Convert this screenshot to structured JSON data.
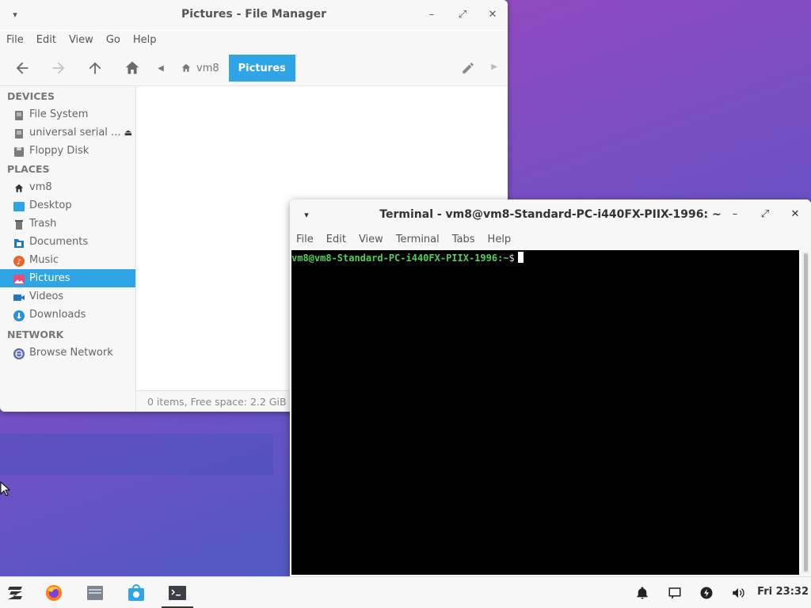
{
  "file_manager": {
    "title": "Pictures - File Manager",
    "menu": [
      "File",
      "Edit",
      "View",
      "Go",
      "Help"
    ],
    "toolbar": {
      "back_icon": "arrow-left-icon",
      "forward_icon": "arrow-right-icon",
      "up_icon": "arrow-up-icon",
      "home_icon": "home-icon"
    },
    "path": {
      "crumbs": [
        {
          "label": "vm8",
          "icon": "home-icon"
        },
        {
          "label": "Pictures",
          "active": true
        }
      ]
    },
    "sidebar": {
      "sections": [
        {
          "header": "DEVICES",
          "items": [
            {
              "label": "File System",
              "icon": "drive-icon"
            },
            {
              "label": "universal serial ...",
              "icon": "usb-drive-icon",
              "eject": true
            },
            {
              "label": "Floppy Disk",
              "icon": "floppy-icon"
            }
          ]
        },
        {
          "header": "PLACES",
          "items": [
            {
              "label": "vm8",
              "icon": "home-icon"
            },
            {
              "label": "Desktop",
              "icon": "desktop-icon"
            },
            {
              "label": "Trash",
              "icon": "trash-icon"
            },
            {
              "label": "Documents",
              "icon": "documents-icon"
            },
            {
              "label": "Music",
              "icon": "music-icon"
            },
            {
              "label": "Pictures",
              "icon": "pictures-icon",
              "selected": true
            },
            {
              "label": "Videos",
              "icon": "videos-icon"
            },
            {
              "label": "Downloads",
              "icon": "downloads-icon"
            }
          ]
        },
        {
          "header": "NETWORK",
          "items": [
            {
              "label": "Browse Network",
              "icon": "network-icon"
            }
          ]
        }
      ]
    },
    "status": "0 items, Free space: 2.2 GiB"
  },
  "terminal": {
    "title": "Terminal - vm8@vm8-Standard-PC-i440FX-PIIX-1996: ~",
    "menu": [
      "File",
      "Edit",
      "View",
      "Terminal",
      "Tabs",
      "Help"
    ],
    "prompt": "vm8@vm8-Standard-PC-i440FX-PIIX-1996",
    "cwd": ":~",
    "symbol": "$"
  },
  "taskbar": {
    "apps": [
      "zorin-menu-icon",
      "firefox-icon",
      "files-icon",
      "software-store-icon",
      "terminal-icon"
    ],
    "tray": [
      "bell-icon",
      "display-icon",
      "power-icon",
      "volume-icon"
    ],
    "clock": "Fri 23:32"
  },
  "colors": {
    "accent": "#2fa4e7",
    "prompt_green": "#4ecf5a"
  }
}
